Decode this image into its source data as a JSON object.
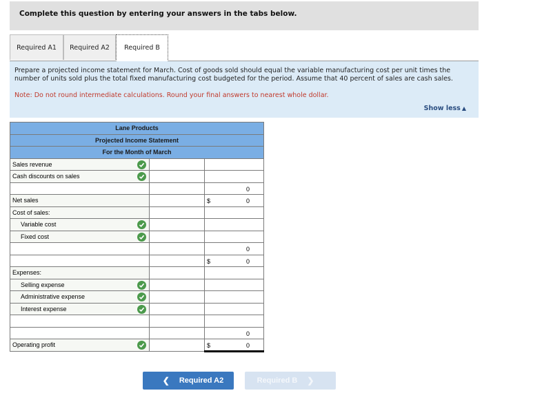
{
  "banner": {
    "text": "Complete this question by entering your answers in the tabs below."
  },
  "tabs": [
    {
      "label": "Required A1",
      "active": false
    },
    {
      "label": "Required A2",
      "active": false
    },
    {
      "label": "Required B",
      "active": true
    }
  ],
  "instructions": {
    "text": "Prepare a projected income statement for March. Cost of goods sold should equal the variable manufacturing cost per unit times the number of units sold plus the total fixed manufacturing cost budgeted for the period. Assume that 40 percent of sales are cash sales.",
    "note": "Note: Do not round intermediate calculations. Round your final answers to nearest whole dollar.",
    "show_less": "Show less",
    "show_less_icon": "triangle-up-icon"
  },
  "statement": {
    "company": "Lane Products",
    "title": "Projected Income Statement",
    "period": "For the Month of March",
    "rows": [
      {
        "label": "Sales revenue",
        "check": true,
        "col1": "",
        "dollar": "",
        "col2": ""
      },
      {
        "label": "Cash discounts on sales",
        "check": true,
        "col1": "",
        "dollar": "",
        "col2": ""
      },
      {
        "label": "",
        "check": false,
        "col1": "",
        "dollar": "",
        "col2": "0"
      },
      {
        "label": "Net sales",
        "check": false,
        "col1": "",
        "dollar": "$",
        "col2": "0"
      },
      {
        "label": "Cost of sales:",
        "check": false,
        "col1": "",
        "dollar": "",
        "col2": ""
      },
      {
        "label": "Variable cost",
        "check": true,
        "col1": "",
        "dollar": "",
        "col2": ""
      },
      {
        "label": "Fixed cost",
        "check": true,
        "col1": "",
        "dollar": "",
        "col2": ""
      },
      {
        "label": "",
        "check": false,
        "col1": "",
        "dollar": "",
        "col2": "0"
      },
      {
        "label": "",
        "check": false,
        "col1": "",
        "dollar": "$",
        "col2": "0"
      },
      {
        "label": "Expenses:",
        "check": false,
        "col1": "",
        "dollar": "",
        "col2": ""
      },
      {
        "label": "Selling expense",
        "check": true,
        "col1": "",
        "dollar": "",
        "col2": ""
      },
      {
        "label": "Administrative expense",
        "check": true,
        "col1": "",
        "dollar": "",
        "col2": ""
      },
      {
        "label": "Interest expense",
        "check": true,
        "col1": "",
        "dollar": "",
        "col2": ""
      },
      {
        "label": "",
        "check": false,
        "col1": "",
        "dollar": "",
        "col2": ""
      },
      {
        "label": "",
        "check": false,
        "col1": "",
        "dollar": "",
        "col2": "0"
      },
      {
        "label": "Operating profit",
        "check": true,
        "col1": "",
        "dollar": "$",
        "col2": "0"
      }
    ]
  },
  "nav": {
    "prev_label": "Required A2",
    "next_label": "Required B",
    "prev_icon": "chevron-left-icon",
    "next_icon": "chevron-right-icon"
  },
  "colors": {
    "header_blue": "#7aaee4",
    "panel_blue": "#dcebf7",
    "note_red": "#c0392b",
    "check_green": "#4c9a4c",
    "prev_button": "#3a78bf",
    "next_button_disabled": "#d7e3f1"
  }
}
